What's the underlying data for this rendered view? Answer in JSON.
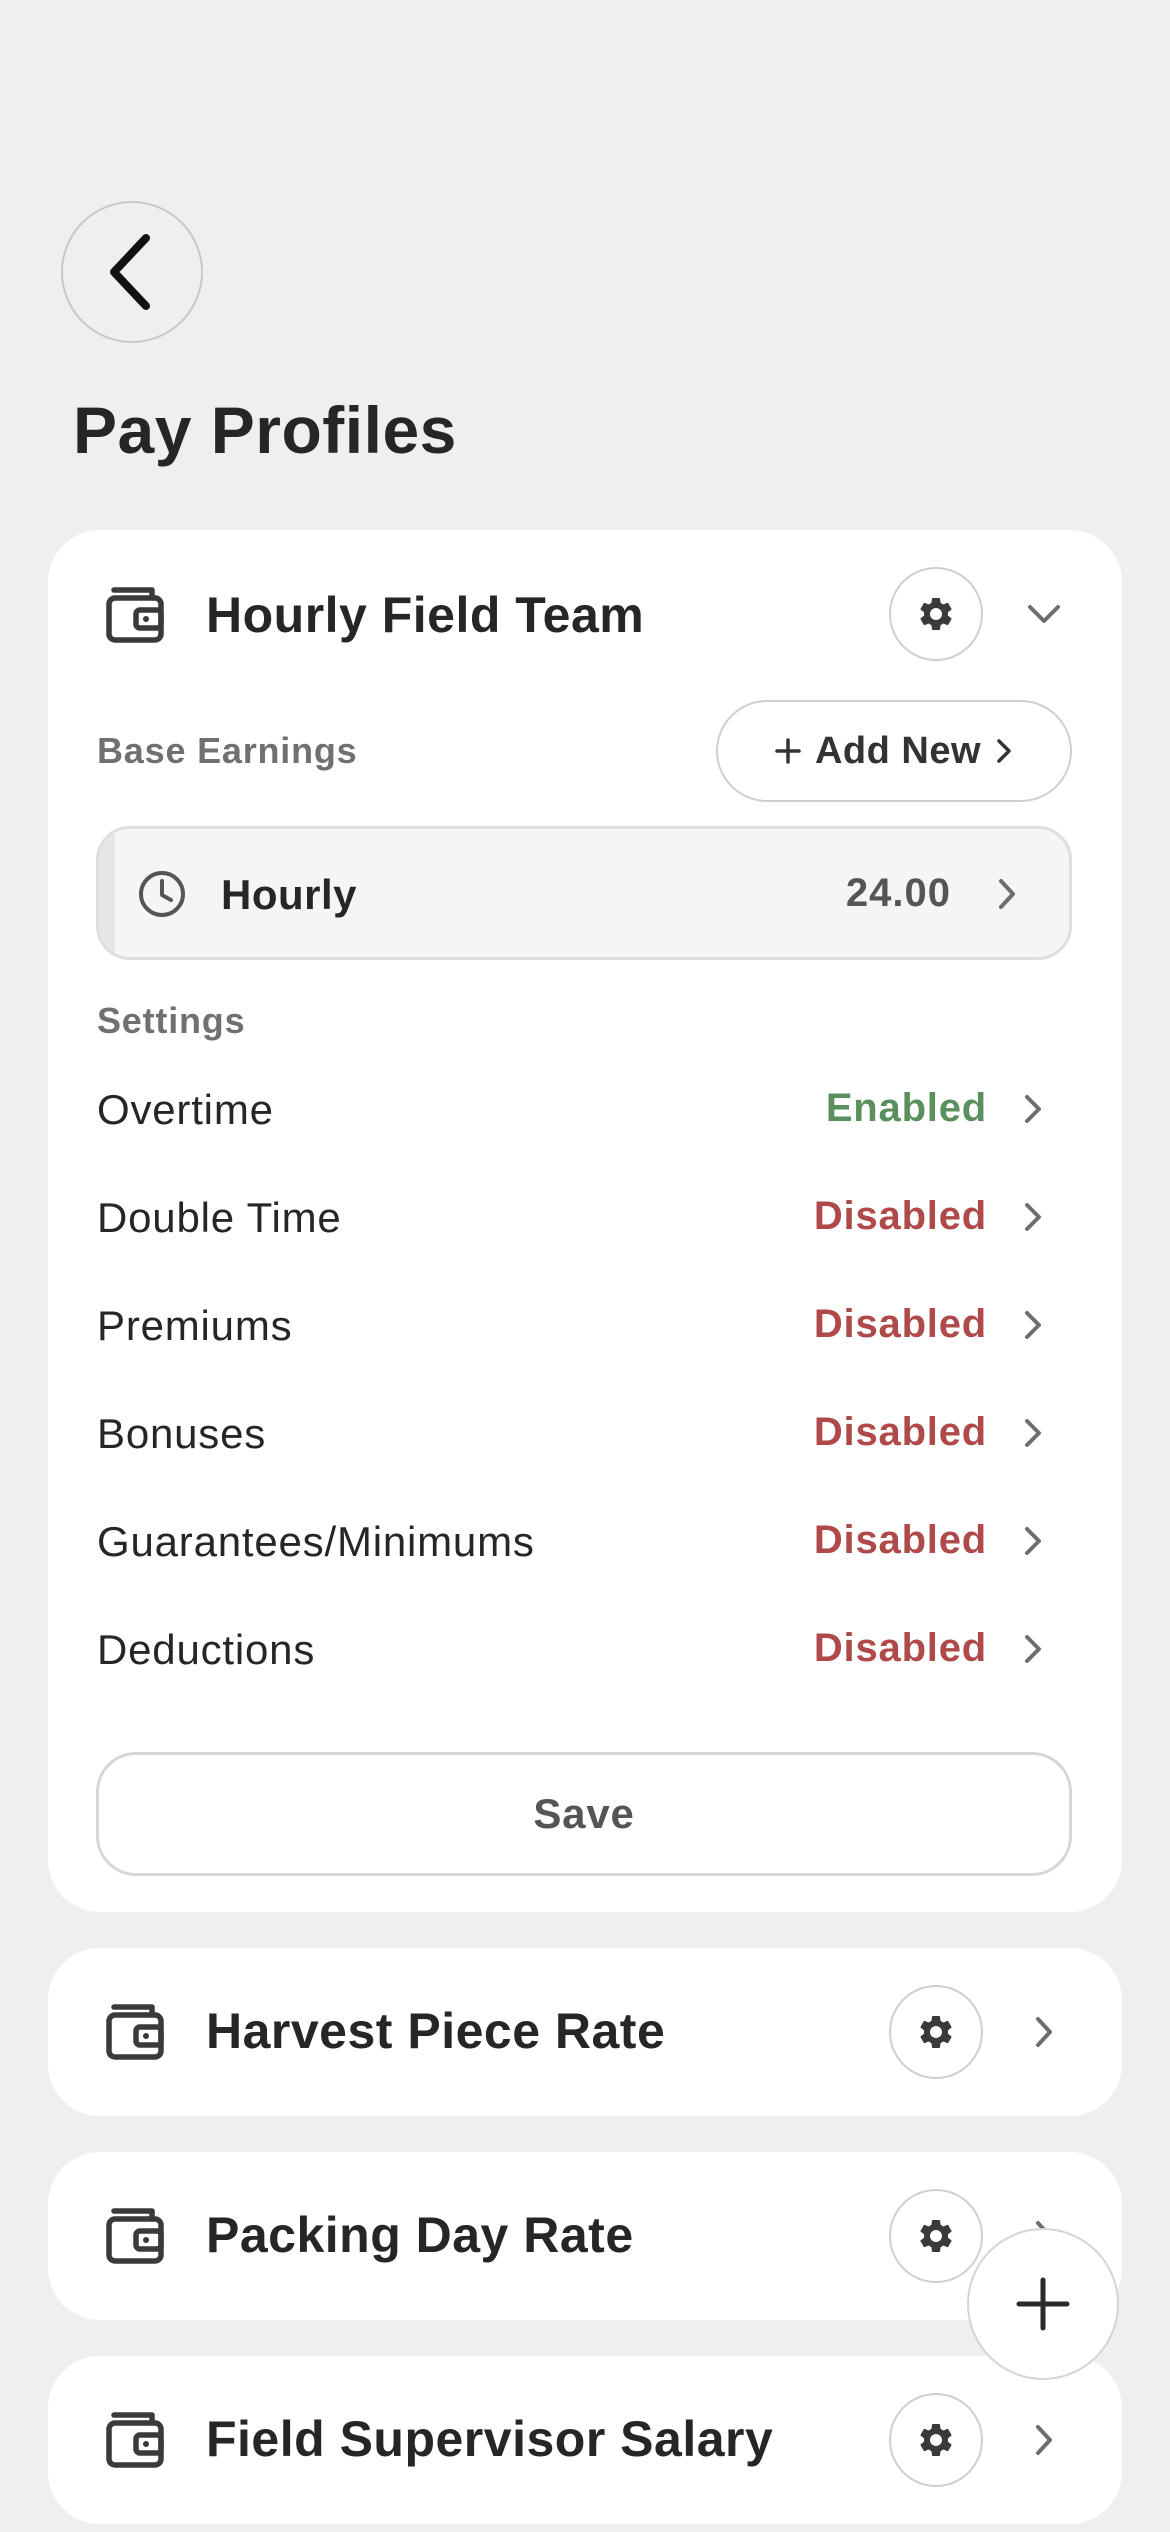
{
  "page": {
    "title": "Pay Profiles"
  },
  "colors": {
    "enabled": "#5a8f5e",
    "disabled": "#b04a4a",
    "background": "#efefef",
    "card": "#ffffff"
  },
  "profiles": [
    {
      "name": "Hourly Field Team",
      "expanded": true,
      "base_earnings": {
        "label": "Base Earnings",
        "add_new_label": "Add New",
        "items": [
          {
            "label": "Hourly",
            "value": "24.00",
            "icon": "clock-icon"
          }
        ]
      },
      "settings": {
        "label": "Settings",
        "items": [
          {
            "label": "Overtime",
            "status": "Enabled"
          },
          {
            "label": "Double Time",
            "status": "Disabled"
          },
          {
            "label": "Premiums",
            "status": "Disabled"
          },
          {
            "label": "Bonuses",
            "status": "Disabled"
          },
          {
            "label": "Guarantees/Minimums",
            "status": "Disabled"
          },
          {
            "label": "Deductions",
            "status": "Disabled"
          }
        ]
      },
      "save_label": "Save"
    },
    {
      "name": "Harvest Piece Rate",
      "expanded": false
    },
    {
      "name": "Packing Day Rate",
      "expanded": false
    },
    {
      "name": "Field Supervisor Salary",
      "expanded": false
    }
  ],
  "icons": {
    "back": "chevron-left-icon",
    "profile": "wallet-icon",
    "settings": "gear-icon",
    "expand": "chevron-down-icon",
    "open": "chevron-right-icon",
    "add": "plus-icon"
  }
}
